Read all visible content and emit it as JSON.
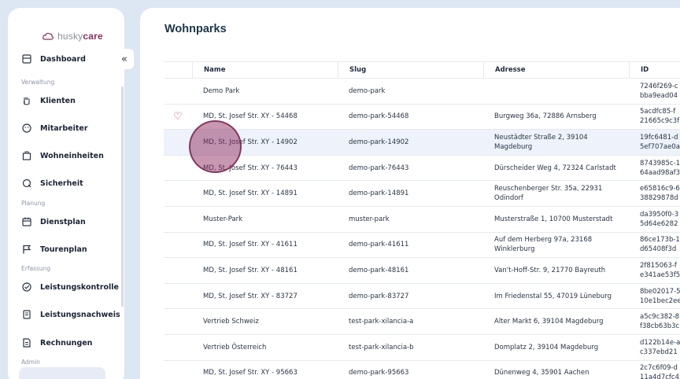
{
  "brand": {
    "part1": "husky",
    "part2": "care"
  },
  "sidebar": {
    "collapse_icon": "«",
    "items": [
      {
        "label": "Dashboard",
        "icon": "dashboard-icon"
      },
      {
        "label": "Klienten",
        "icon": "hand-icon"
      },
      {
        "label": "Mitarbeiter",
        "icon": "face-icon"
      },
      {
        "label": "Wohneinheiten",
        "icon": "building-icon"
      },
      {
        "label": "Sicherheit",
        "icon": "shield-icon"
      },
      {
        "label": "Dienstplan",
        "icon": "calendar-icon"
      },
      {
        "label": "Tourenplan",
        "icon": "flag-icon"
      },
      {
        "label": "Leistungskontrolle",
        "icon": "check-circle-icon"
      },
      {
        "label": "Leistungsnachweis",
        "icon": "document-icon"
      },
      {
        "label": "Rechnungen",
        "icon": "invoice-icon"
      }
    ],
    "sections": [
      "Verwaltung",
      "Planung",
      "Erfassung",
      "Admin"
    ]
  },
  "main": {
    "title": "Wohnparks",
    "columns": [
      "Name",
      "Slug",
      "Adresse",
      "ID"
    ],
    "rows": [
      {
        "name": "Demo Park",
        "slug": "demo-park",
        "addr1": "",
        "addr2": "",
        "id1": "7246f269-c",
        "id2": "bba9ead04"
      },
      {
        "name": "MD, St. Josef Str. XY - 54468",
        "slug": "demo-park-54468",
        "addr1": "Burgweg 36a, 72886 Arnsberg",
        "addr2": "",
        "id1": "5acdfc85-f",
        "id2": "21665c9c3f",
        "fav": true
      },
      {
        "name": "MD, St. Josef Str. XY - 14902",
        "slug": "demo-park-14902",
        "addr1": "Neustädter Straße 2, 39104",
        "addr2": "Magdeburg",
        "id1": "19fc6481-d",
        "id2": "5ef707ae0a"
      },
      {
        "name": "MD, St. Josef Str. XY - 76443",
        "slug": "demo-park-76443",
        "addr1": "Dürscheider Weg 4, 72324 Carlstadt",
        "addr2": "",
        "id1": "8743985c-1",
        "id2": "64aad98af3"
      },
      {
        "name": "MD, St. Josef Str. XY - 14891",
        "slug": "demo-park-14891",
        "addr1": "Reuschenberger Str. 35a, 22931",
        "addr2": "Odindorf",
        "id1": "e65816c9-6",
        "id2": "38829878d"
      },
      {
        "name": "Muster-Park",
        "slug": "muster-park",
        "addr1": "Musterstraße 1, 10700 Musterstadt",
        "addr2": "",
        "id1": "da3950f0-3",
        "id2": "5d64e6282"
      },
      {
        "name": "MD, St. Josef Str. XY - 41611",
        "slug": "demo-park-41611",
        "addr1": "Auf dem Herberg 97a, 23168",
        "addr2": "Winklerburg",
        "id1": "86ce173b-1",
        "id2": "d65408f3d"
      },
      {
        "name": "MD, St. Josef Str. XY - 48161",
        "slug": "demo-park-48161",
        "addr1": "Van't-Hoff-Str. 9, 21770 Bayreuth",
        "addr2": "",
        "id1": "2f815063-f",
        "id2": "e341ae53f5"
      },
      {
        "name": "MD, St. Josef Str. XY - 83727",
        "slug": "demo-park-83727",
        "addr1": "Im Friedenstal 55, 47019 Lüneburg",
        "addr2": "",
        "id1": "8be02017-5",
        "id2": "10e1bec2ee"
      },
      {
        "name": "Vertrieb Schweiz",
        "slug": "test-park-xilancia-a",
        "addr1": "Alter Markt 6, 39104 Magdeburg",
        "addr2": "",
        "id1": "a5c9c382-8",
        "id2": "f38cb63b3c"
      },
      {
        "name": "Vertrieb Österreich",
        "slug": "test-park-xilancia-b",
        "addr1": "Domplatz 2, 39104 Magdeburg",
        "addr2": "",
        "id1": "d122b14e-a",
        "id2": "c337ebd21"
      },
      {
        "name": "MD, St. Josef Str. XY - 95663",
        "slug": "demo-park-95663",
        "addr1": "Dünenweg 4, 35901 Aachen",
        "addr2": "",
        "id1": "2c7c6f09-d",
        "id2": "11a4d7cfc4"
      }
    ]
  },
  "colors": {
    "accent": "#8a2f5e",
    "heart": "#d23a4a",
    "selected_row": "#edf2fb"
  }
}
